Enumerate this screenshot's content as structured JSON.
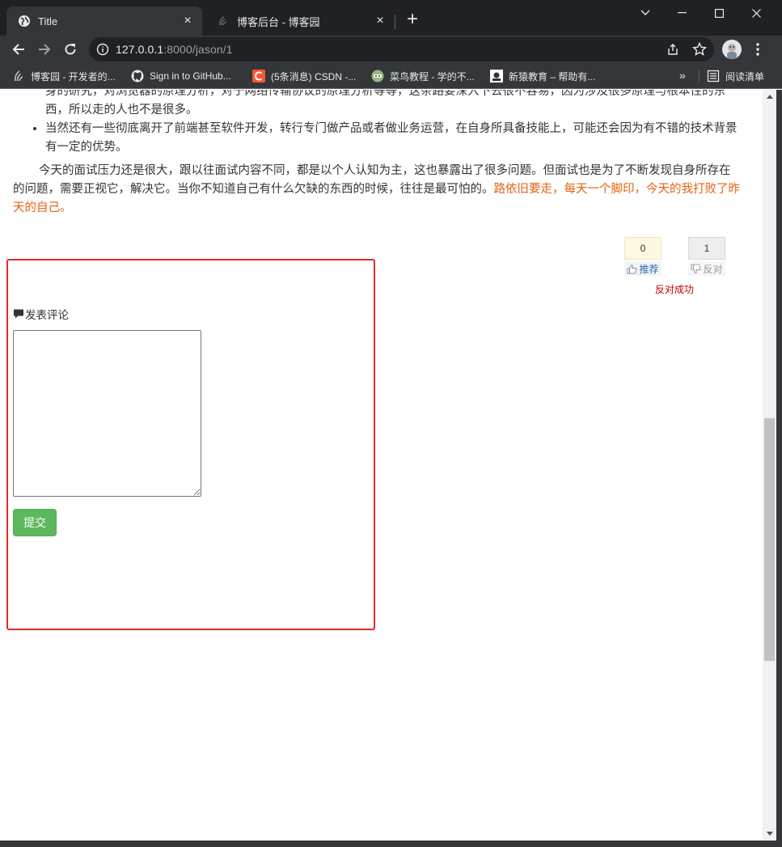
{
  "browser": {
    "tabs": [
      {
        "title": "Title",
        "active": true
      },
      {
        "title": "博客后台 - 博客园",
        "active": false
      }
    ],
    "url": {
      "host": "127.0.0.1",
      "rest": ":8000/jason/1"
    },
    "bookmarks": [
      {
        "label": "博客园 - 开发者的...",
        "icon": "cnblogs-icon"
      },
      {
        "label": "Sign in to GitHub...",
        "icon": "github-icon"
      },
      {
        "label": "(5条消息) CSDN -...",
        "icon": "csdn-icon"
      },
      {
        "label": "菜鸟教程 - 学的不...",
        "icon": "runoob-icon"
      },
      {
        "label": "新猿教育 – 帮助有...",
        "icon": "xinyuan-icon"
      }
    ],
    "more_bookmarks": "»",
    "reading_list": "阅读清单"
  },
  "article": {
    "bullet_1_fragment": "身的研究，对浏览器的原理分析，对于网络传输协议的原理分析等等，这条路要深入下去很不容易，因为涉及很多原理与根本性的东西，所以走的人也不是很多。",
    "bullet_2": "当然还有一些彻底离开了前端甚至软件开发，转行专门做产品或者做业务运营，在自身所具备技能上，可能还会因为有不错的技术背景有一定的优势。",
    "paragraph": "今天的面试压力还是很大，跟以往面试内容不同，都是以个人认知为主，这也暴露出了很多问题。但面试也是为了不断发现自身所存在的问题，需要正视它，解决它。当你不知道自己有什么欠缺的东西的时候，往往是最可怕的。",
    "highlight": "路依旧要走，每天一个脚印，今天的我打败了昨天的自己。",
    "highlight_color": "#e8620f"
  },
  "votes": {
    "up_count": "0",
    "up_label": "推荐",
    "down_count": "1",
    "down_label": "反对",
    "message": "反对成功"
  },
  "comment": {
    "heading": "发表评论",
    "textarea_value": "",
    "submit_label": "提交",
    "box_border_color": "#e4282a",
    "submit_color": "#5cb85c"
  }
}
